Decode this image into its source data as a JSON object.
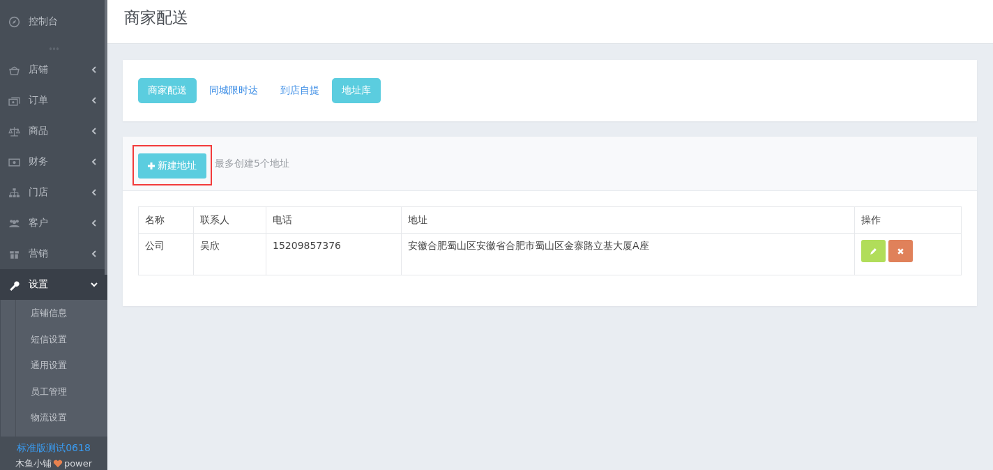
{
  "sidebar": {
    "items": [
      {
        "label": "控制台",
        "selected": false
      },
      {
        "label": "店铺",
        "expanded": false,
        "selected": false
      },
      {
        "label": "订单",
        "expanded": false,
        "selected": false
      },
      {
        "label": "商品",
        "expanded": false,
        "selected": false
      },
      {
        "label": "财务",
        "expanded": false,
        "selected": false
      },
      {
        "label": "门店",
        "expanded": false,
        "selected": false
      },
      {
        "label": "客户",
        "expanded": false,
        "selected": false
      },
      {
        "label": "营销",
        "expanded": false,
        "selected": false
      },
      {
        "label": "设置",
        "expanded": true,
        "selected": true,
        "children": [
          {
            "label": "店铺信息"
          },
          {
            "label": "短信设置"
          },
          {
            "label": "通用设置"
          },
          {
            "label": "员工管理"
          },
          {
            "label": "物流设置"
          }
        ]
      }
    ],
    "footer": {
      "version": "标准版测试0618",
      "brand": "木鱼小铺",
      "powered": "power"
    }
  },
  "page_title": "商家配送",
  "tabs": [
    {
      "label": "商家配送",
      "selected": true
    },
    {
      "label": "同城限时达",
      "selected": false
    },
    {
      "label": "到店自提",
      "selected": false
    },
    {
      "label": "地址库",
      "selected": true
    }
  ],
  "new_button": {
    "label": "新建地址",
    "highlighted": true
  },
  "hint": "最多创建5个地址",
  "table": {
    "columns": [
      "名称",
      "联系人",
      "电话",
      "地址",
      "操作"
    ],
    "rows": [
      {
        "cells": [
          "公司",
          "吴欣",
          "15209857376",
          "安徽合肥蜀山区安徽省合肥市蜀山区金寨路立基大厦A座"
        ]
      }
    ]
  }
}
